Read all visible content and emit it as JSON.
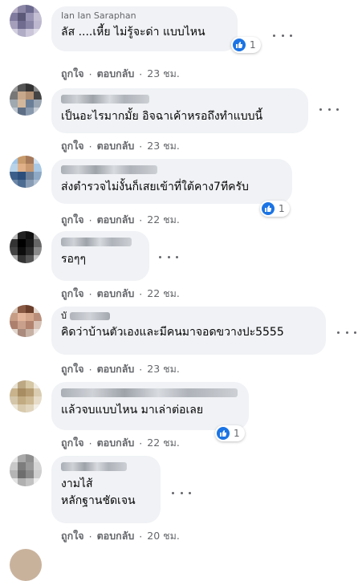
{
  "comments": [
    {
      "name": "Ian Ian Saraphan",
      "text": "ลัส ....เหี้ย ไม่รู้จะด่า แบบไหน",
      "reaction_count": "1",
      "like": "ถูกใจ",
      "reply": "ตอบกลับ",
      "time": "23 ชม."
    },
    {
      "name": "",
      "text": "เป็นอะไรมากมั้ย อิจฉาเค้าหรอถึงทำแบบนี้",
      "reaction_count": "",
      "like": "ถูกใจ",
      "reply": "ตอบกลับ",
      "time": "23 ชม."
    },
    {
      "name": "",
      "text": "ส่งตำรวจไม่งั้นก็เสยเข้าที่ใต้คาง7ทีครับ",
      "reaction_count": "1",
      "like": "ถูกใจ",
      "reply": "ตอบกลับ",
      "time": "22 ชม."
    },
    {
      "name": "",
      "text": "รอๆๆ",
      "reaction_count": "",
      "like": "ถูกใจ",
      "reply": "ตอบกลับ",
      "time": "22 ชม."
    },
    {
      "name": "บั",
      "text": "คิดว่าบ้านตัวเองและมีคนมาจอดขวางปะ5555",
      "reaction_count": "",
      "like": "ถูกใจ",
      "reply": "ตอบกลับ",
      "time": "23 ชม."
    },
    {
      "name": "",
      "text": "แล้วจบแบบไหน มาเล่าต่อเลย",
      "reaction_count": "1",
      "like": "ถูกใจ",
      "reply": "ตอบกลับ",
      "time": "22 ชม."
    },
    {
      "name": "",
      "text": "งามไส้\nหลักฐานชัดเจน",
      "reaction_count": "",
      "like": "ถูกใจ",
      "reply": "ตอบกลับ",
      "time": "20 ชม."
    }
  ],
  "icons": {
    "like": "like-thumb-icon",
    "more": "more-options-icon"
  },
  "colors": {
    "bubble": "#f0f2f5",
    "like_blue": "#1b74e4",
    "meta": "#65676b"
  }
}
